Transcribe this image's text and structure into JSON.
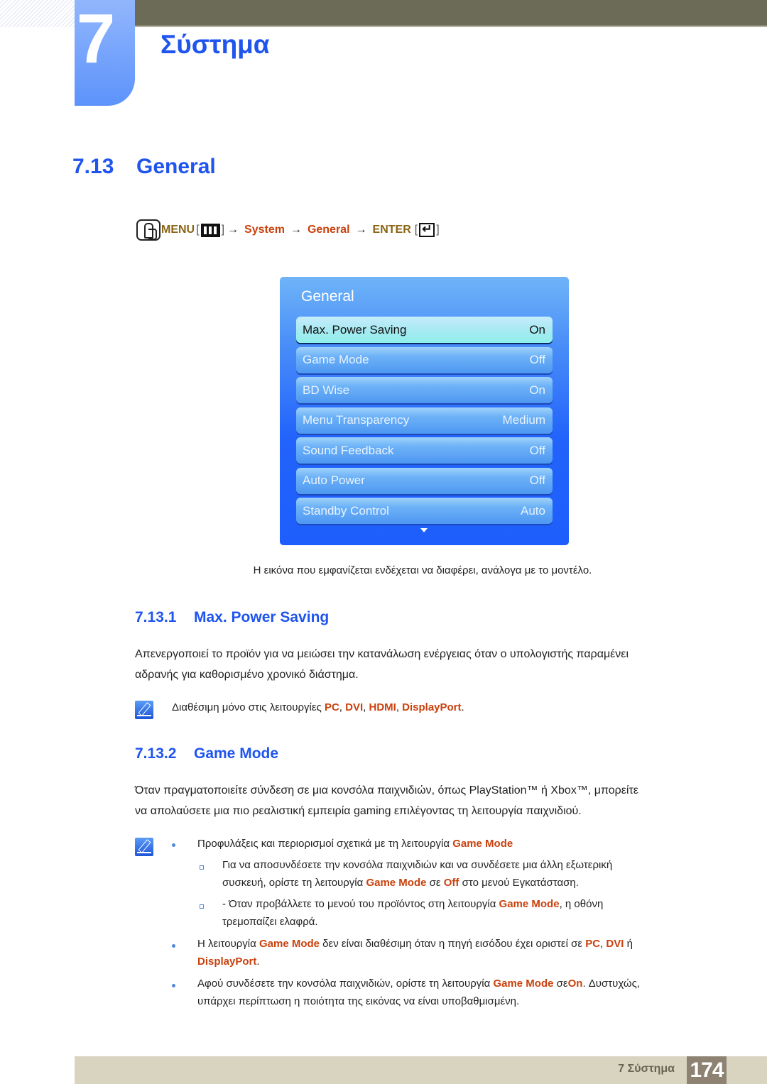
{
  "chapter": {
    "number": "7",
    "title": "Σύστημα"
  },
  "section": {
    "number": "7.13",
    "title": "General"
  },
  "menu_path": {
    "menu_label": "MENU",
    "arrow": "→",
    "items": [
      "System",
      "General"
    ],
    "enter_label": "ENTER",
    "bracket_open": "[",
    "bracket_close": "]"
  },
  "osd": {
    "title": "General",
    "items": [
      {
        "label": "Max. Power Saving",
        "value": "On",
        "selected": true
      },
      {
        "label": "Game Mode",
        "value": "Off",
        "selected": false
      },
      {
        "label": "BD Wise",
        "value": "On",
        "selected": false
      },
      {
        "label": "Menu Transparency",
        "value": "Medium",
        "selected": false
      },
      {
        "label": "Sound Feedback",
        "value": "Off",
        "selected": false
      },
      {
        "label": "Auto Power",
        "value": "Off",
        "selected": false
      },
      {
        "label": "Standby Control",
        "value": "Auto",
        "selected": false
      }
    ]
  },
  "caption": "Η εικόνα που εμφανίζεται ενδέχεται να διαφέρει, ανάλογα με το μοντέλο.",
  "subsections": [
    {
      "number": "7.13.1",
      "title": "Max. Power Saving",
      "body": [
        "Απενεργοποιεί το προϊόν για να μειώσει την κατανάλωση ενέργειας όταν ο υπολογιστής παραμένει",
        "αδρανής για καθορισμένο χρονικό διάστημα."
      ],
      "note": {
        "prefix": "Διαθέσιμη μόνο στις λειτουργίες ",
        "terms": [
          "PC",
          "DVI",
          "HDMI",
          "DisplayPort"
        ],
        "sep": ", ",
        "suffix": "."
      }
    },
    {
      "number": "7.13.2",
      "title": "Game Mode",
      "body": [
        "Όταν πραγματοποιείτε σύνδεση σε μια κονσόλα παιχνιδιών, όπως PlayStation™ ή Xbox™, μπορείτε",
        "να απολαύσετε μια πιο ρεαλιστική εμπειρία gaming επιλέγοντας τη λειτουργία παιχνιδιού."
      ],
      "notes": {
        "b1": {
          "text": "Προφυλάξεις και περιορισμοί σχετικά με τη λειτουργία ",
          "term": "Game Mode"
        },
        "s1": {
          "l1": "Για να αποσυνδέσετε την κονσόλα παιχνιδιών και να συνδέσετε μια άλλη εξωτερική",
          "l2a": "συσκευή, ορίστε τη λειτουργία ",
          "term1": "Game Mode",
          "l2b": " σε ",
          "term2": "Off",
          "l2c": " στο μενού Εγκατάσταση."
        },
        "s2": {
          "l1a": "- Όταν προβάλλετε το μενού του προϊόντος στη λειτουργία ",
          "term": "Game Mode",
          "l1b": ", η οθόνη",
          "l2": "τρεμοπαίζει ελαφρά."
        },
        "b2": {
          "a": "Η λειτουργία ",
          "term1": "Game Mode",
          "b": " δεν είναι διαθέσιμη όταν η πηγή εισόδου έχει οριστεί σε ",
          "term2": "PC",
          "c": ", ",
          "term3": "DVI",
          "d": " ή",
          "term4": "DisplayPort",
          "e": "."
        },
        "b3": {
          "a": "Αφού συνδέσετε την κονσόλα παιχνιδιών, ορίστε τη λειτουργία ",
          "term1": "Game Mode",
          "b": " σε",
          "term2": "On",
          "c": ". Δυστυχώς,",
          "l2": "υπάρχει περίπτωση η ποιότητα της εικόνας να είναι υποβαθμισμένη."
        }
      }
    }
  ],
  "footer": {
    "label": "7 Σύστημα",
    "page": "174"
  }
}
